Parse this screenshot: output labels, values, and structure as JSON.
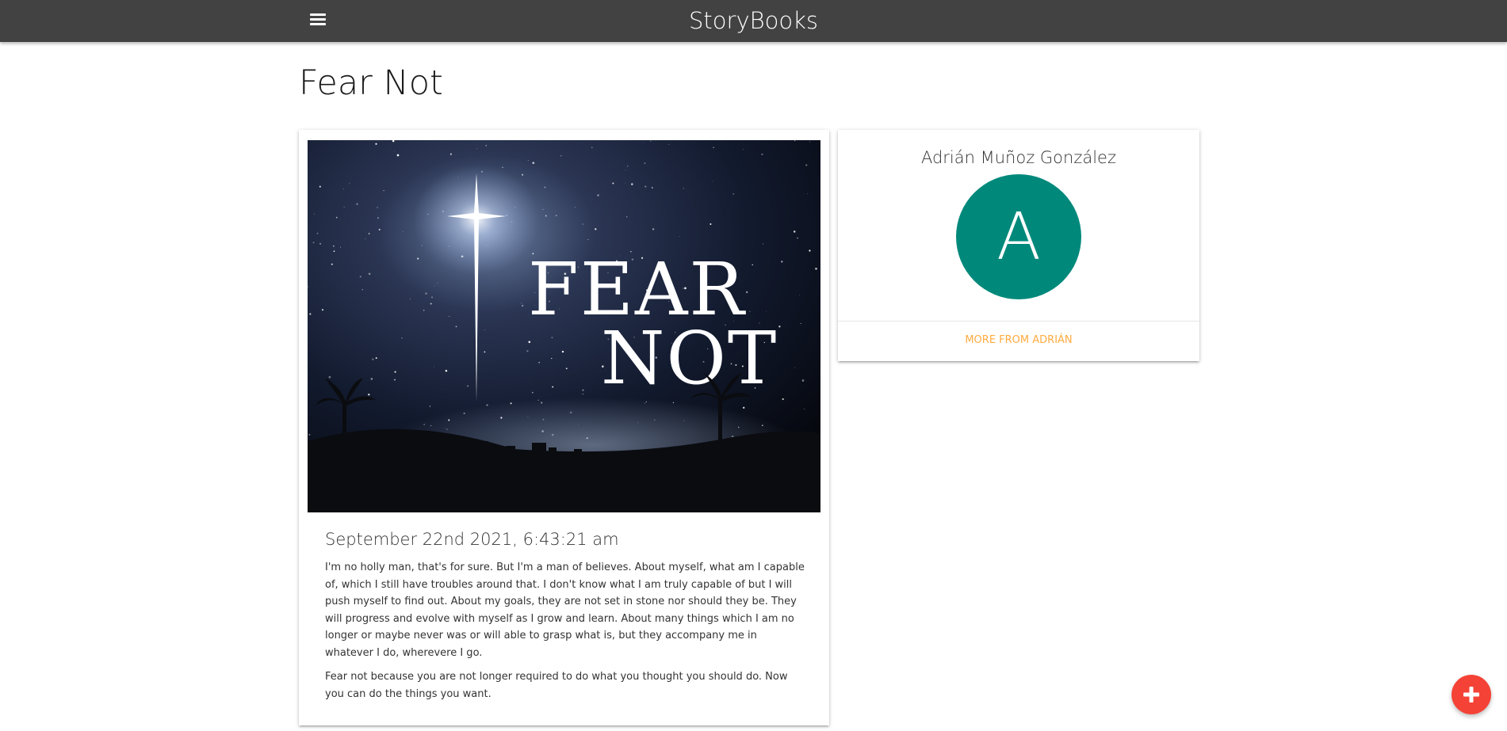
{
  "navbar": {
    "brand": "StoryBooks",
    "menu_icon": "hamburger-menu-icon",
    "background_color": "#424242"
  },
  "page": {
    "title": "Fear Not"
  },
  "story": {
    "image": {
      "text_line1": "FEAR",
      "text_line2": "NOT"
    },
    "date": "September 22nd 2021, 6:43:21 am",
    "paragraphs": [
      "I'm no holly man, that's for sure. But I'm a man of believes. About myself, what am I capable of, which I still have troubles around that. I don't know what I am truly capable of but I will push myself to find out. About my goals, they are not set in stone nor should they be. They will progress and evolve with myself as I grow and learn. About many things which I am no longer or maybe never was or will able to grasp what is, but they accompany me in whatever I do, wherevere I go.",
      "Fear not because you are not longer required to do what you thought you should do. Now you can do the things you want."
    ]
  },
  "author": {
    "name": "Adrián Muñoz González",
    "avatar_letter": "A",
    "avatar_color": "#00897b",
    "more_link": "More From Adrián",
    "link_color": "#ffab40"
  },
  "fab": {
    "icon": "plus-icon",
    "color": "#f44336"
  }
}
